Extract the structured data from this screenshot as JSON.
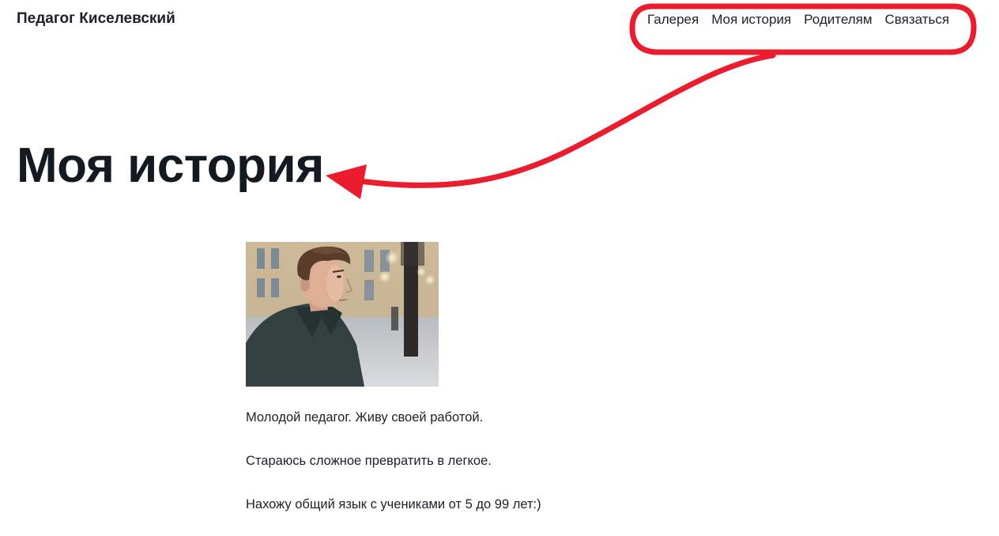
{
  "header": {
    "site_title": "Педагог Киселевский",
    "nav": [
      {
        "label": "Галерея"
      },
      {
        "label": "Моя история"
      },
      {
        "label": "Родителям"
      },
      {
        "label": "Связаться"
      }
    ]
  },
  "main": {
    "title": "Моя история",
    "paragraphs": [
      "Молодой педагог. Живу своей работой.",
      "Стараюсь сложное превратить в легкое.",
      "Нахожу общий язык с учениками от 5 до 99 лет:)"
    ]
  },
  "colors": {
    "text": "#1b2129",
    "annotation": "#ea1c2d",
    "background": "#ffffff"
  }
}
